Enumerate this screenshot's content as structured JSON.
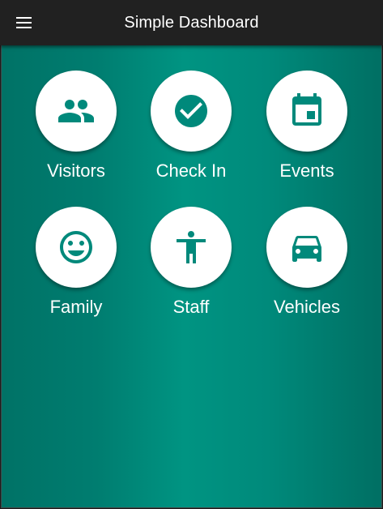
{
  "appbar": {
    "title": "Simple Dashboard",
    "menu_icon": "hamburger-menu-icon"
  },
  "theme": {
    "appbar_color": "#212121",
    "accent": "#009482",
    "icon_color": "#00897b",
    "circle_color": "#ffffff"
  },
  "tiles": [
    {
      "label": "Visitors",
      "icon": "people-icon"
    },
    {
      "label": "Check In",
      "icon": "check-circle-icon"
    },
    {
      "label": "Events",
      "icon": "calendar-event-icon"
    },
    {
      "label": "Family",
      "icon": "smiley-face-icon"
    },
    {
      "label": "Staff",
      "icon": "person-accessibility-icon"
    },
    {
      "label": "Vehicles",
      "icon": "car-icon"
    }
  ]
}
